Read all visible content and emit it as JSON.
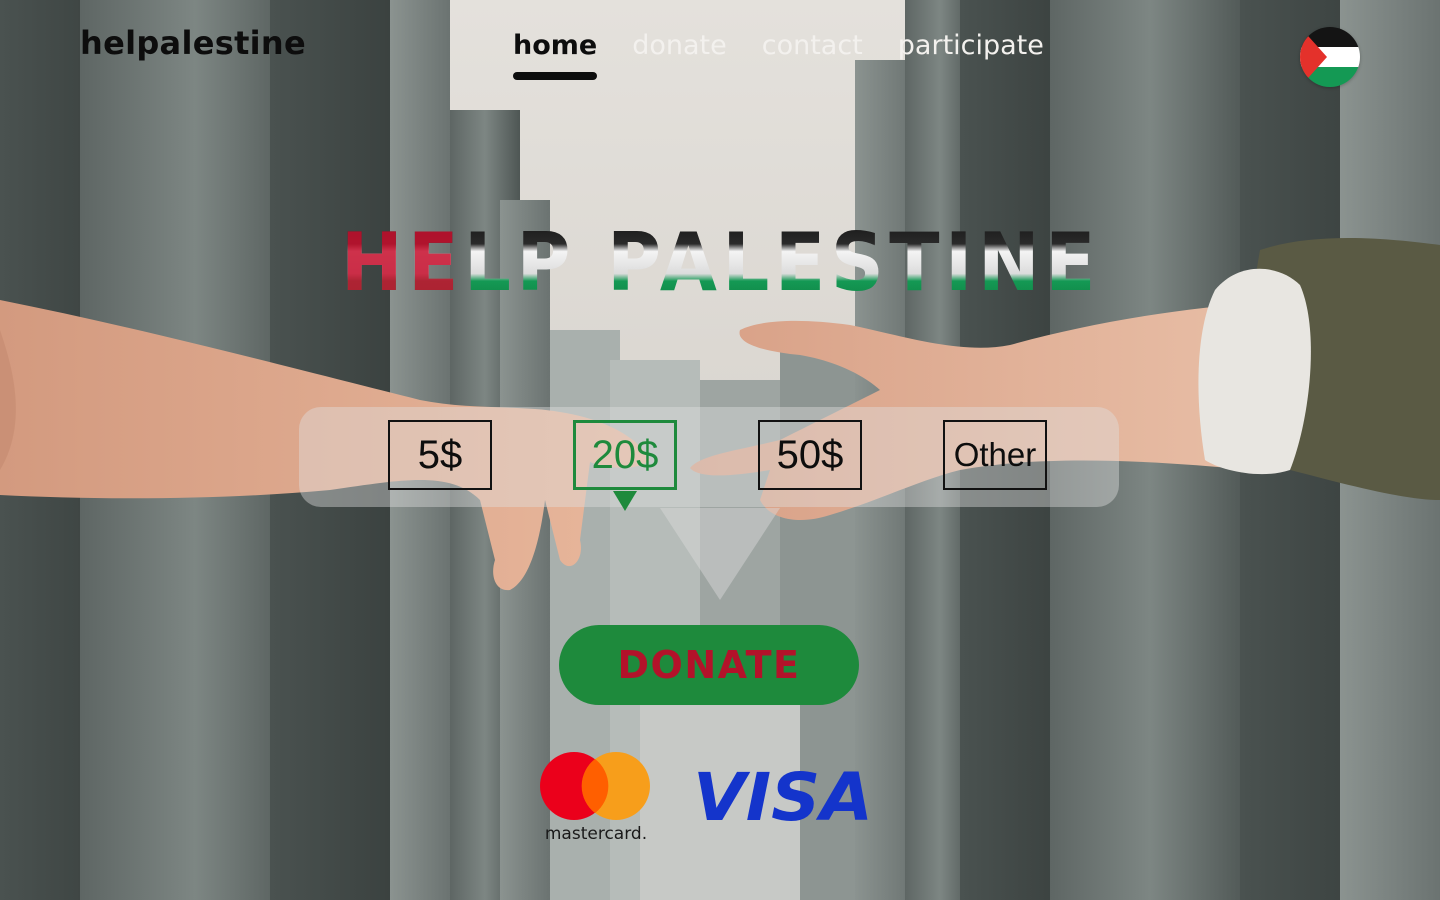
{
  "header": {
    "brand": "helpalestine",
    "nav": [
      {
        "label": "home",
        "active": true
      },
      {
        "label": "donate",
        "active": false
      },
      {
        "label": "contact",
        "active": false
      },
      {
        "label": "participate",
        "active": false
      }
    ],
    "flag_icon": "palestine-flag-icon"
  },
  "hero": {
    "title": "HELP PALESTINE"
  },
  "amounts": {
    "options": [
      "5$",
      "20$",
      "50$",
      "Other"
    ],
    "selected": "20$"
  },
  "donate": {
    "label": "DONATE"
  },
  "payments": {
    "mastercard_wordmark": "mastercard.",
    "visa_wordmark": "VISA"
  },
  "colors": {
    "accent_green": "#1e8a3c",
    "accent_red": "#b3122a",
    "nav_active": "#0d0d0d",
    "nav_inactive": "#f3f1ee",
    "visa_blue": "#1434cb"
  }
}
